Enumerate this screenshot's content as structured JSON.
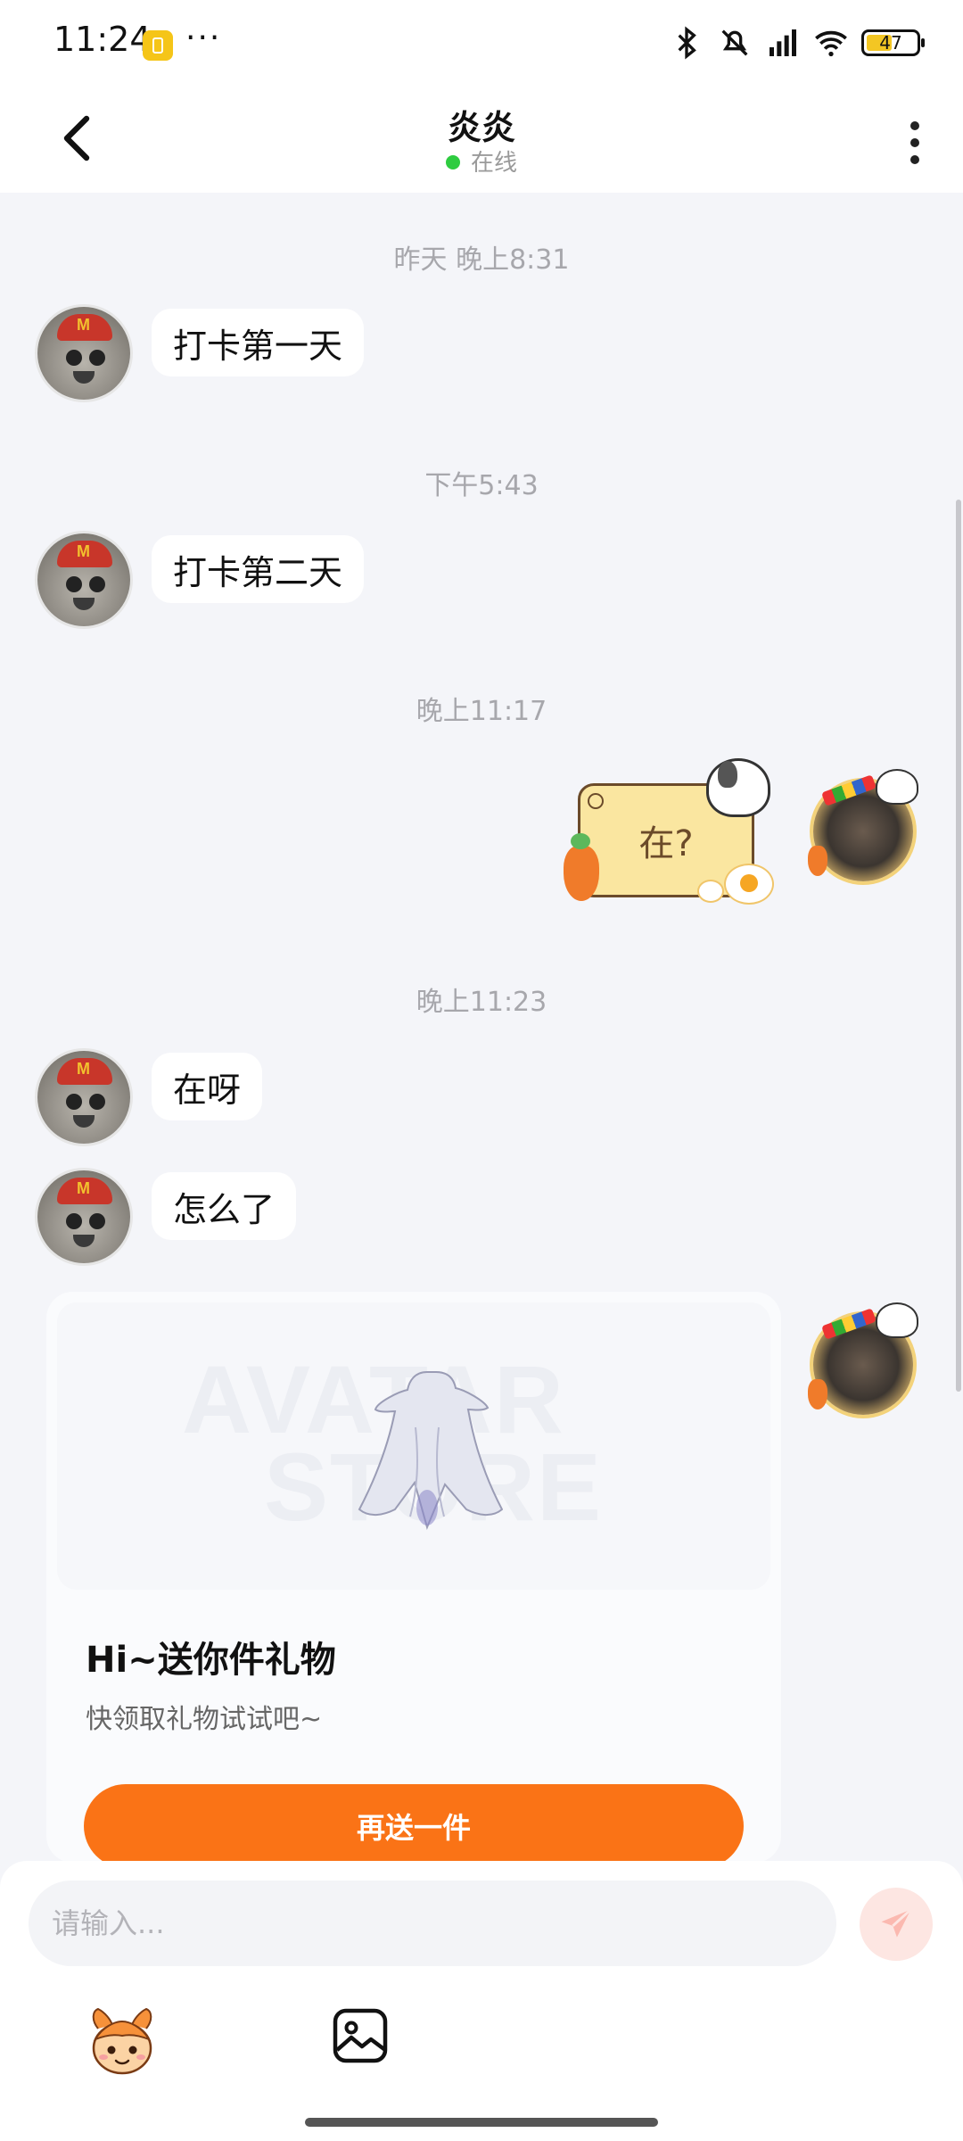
{
  "status_bar": {
    "time": "11:24",
    "more": "···",
    "battery": "47"
  },
  "header": {
    "title": "炎炎",
    "status": "在线"
  },
  "messages": {
    "ts1": "昨天 晚上8:31",
    "m1": "打卡第一天",
    "ts2": "下午5:43",
    "m2": "打卡第二天",
    "ts3": "晚上11:17",
    "sticker_text": "在?",
    "ts4": "晚上11:23",
    "m3": "在呀",
    "m4": "怎么了"
  },
  "gift_card": {
    "watermark_line1": "AVATAR",
    "watermark_line2": "STORE",
    "title": "Hi~送你件礼物",
    "subtitle": "快领取礼物试试吧~",
    "button": "再送一件"
  },
  "composer": {
    "placeholder": "请输入..."
  },
  "colors": {
    "accent": "#fa7316",
    "online": "#2ecc40",
    "send_bg": "#fde6e2"
  },
  "icons": [
    "back-icon",
    "more-icon",
    "bluetooth-icon",
    "mute-icon",
    "signal-icon",
    "wifi-icon",
    "battery-icon",
    "send-icon",
    "mascot-icon",
    "image-icon"
  ]
}
